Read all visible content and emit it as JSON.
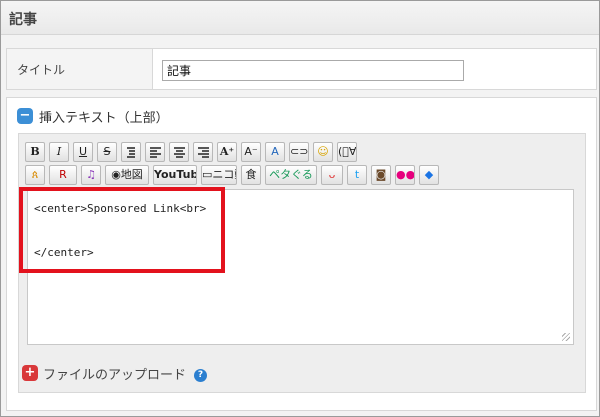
{
  "section": {
    "title": "記事"
  },
  "title_field": {
    "label": "タイトル",
    "value": "記事"
  },
  "insert_text": {
    "label": "挿入テキスト（上部）",
    "toggle": "−"
  },
  "toolbar": {
    "row1": [
      {
        "name": "bold-button",
        "text": "B",
        "cls": "b"
      },
      {
        "name": "italic-button",
        "text": "I",
        "cls": "i"
      },
      {
        "name": "underline-button",
        "text": "U",
        "cls": "u"
      },
      {
        "name": "strikethrough-button",
        "text": "S",
        "cls": "s"
      },
      {
        "name": "list-button",
        "text": "",
        "icon": "list"
      },
      {
        "name": "align-left-button",
        "text": "",
        "icon": "left"
      },
      {
        "name": "align-center-button",
        "text": "",
        "icon": "center"
      },
      {
        "name": "align-right-button",
        "text": "",
        "icon": "right"
      },
      {
        "name": "font-larger-button",
        "text": "A⁺",
        "cls": "b"
      },
      {
        "name": "font-smaller-button",
        "text": "A⁻"
      },
      {
        "name": "font-color-button",
        "text": "A",
        "color": "#2266bb"
      },
      {
        "name": "link-button",
        "text": "⊂⊃"
      },
      {
        "name": "emoji-button",
        "text": "☺",
        "color": "#d8a400"
      },
      {
        "name": "kaomoji-button",
        "text": "(ﾟ∀ﾟ)"
      }
    ],
    "row2": [
      {
        "name": "amazon-button",
        "text": "ጰ",
        "color": "#d88a00"
      },
      {
        "name": "rakuten-button",
        "text": "R",
        "color": "#bf0000"
      },
      {
        "name": "music-button",
        "text": "♫",
        "color": "#8a3ab9"
      },
      {
        "name": "map-button",
        "text": "◉地図"
      },
      {
        "name": "youtube-button",
        "text": "YouTube",
        "youtube": true
      },
      {
        "name": "niconico-button",
        "text": "▭ニコ動"
      },
      {
        "name": "recipe-button",
        "text": "食"
      },
      {
        "name": "petaguru-button",
        "text": "ペタぐる",
        "color": "#1a9a5a"
      },
      {
        "name": "smile-button",
        "text": "ᴗ",
        "color": "#e03a3a"
      },
      {
        "name": "twitter-button",
        "text": "t",
        "color": "#1da1f2"
      },
      {
        "name": "instagram-button",
        "text": "◙",
        "color": "#6b4a2b"
      },
      {
        "name": "flickr-button",
        "text": "●●",
        "color": "#e6007d"
      },
      {
        "name": "dropbox-button",
        "text": "◆",
        "color": "#1b74e4"
      }
    ]
  },
  "code": {
    "line1": "<center>Sponsored Link<br>",
    "line2": "",
    "line3": "</center>"
  },
  "upload": {
    "label": "ファイルのアップロード",
    "toggle": "+",
    "help": "?"
  },
  "colors": {
    "highlight": "#e3121d",
    "accent_blue": "#3c8fd6",
    "accent_red": "#d9383a"
  }
}
